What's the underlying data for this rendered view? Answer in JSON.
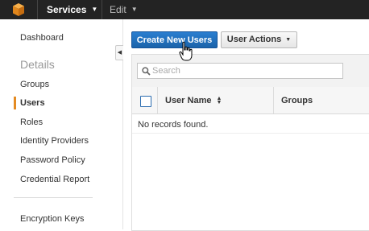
{
  "topbar": {
    "logo_icon": "aws-cube-icon",
    "services_label": "Services",
    "edit_label": "Edit"
  },
  "sidebar": {
    "items": [
      {
        "label": "Dashboard"
      },
      {
        "label": "Groups"
      },
      {
        "label": "Users",
        "active": true
      },
      {
        "label": "Roles"
      },
      {
        "label": "Identity Providers"
      },
      {
        "label": "Password Policy"
      },
      {
        "label": "Credential Report"
      },
      {
        "label": "Encryption Keys"
      }
    ],
    "section_title": "Details",
    "active_accent": "#e48b23",
    "collapse_icon": "collapse-left-icon"
  },
  "toolbar": {
    "create_label": "Create New Users",
    "actions_label": "User Actions"
  },
  "search": {
    "placeholder": "Search",
    "value": ""
  },
  "table": {
    "columns": [
      "User Name",
      "Groups"
    ],
    "empty_message": "No records found."
  },
  "colors": {
    "primary_button": "#1f70c1",
    "topbar": "#232323"
  }
}
